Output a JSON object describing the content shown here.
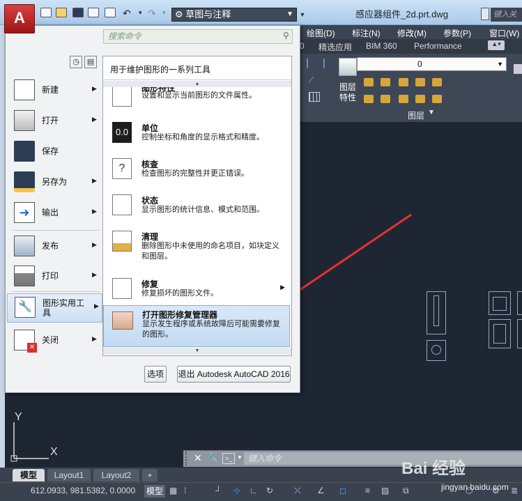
{
  "titlebar": {
    "logo": "A",
    "workspace": "草图与注释",
    "window_title": "感应器组件_2d.prt.dwg",
    "search_placeholder": "键入关键字"
  },
  "menubar": {
    "items": [
      "绘图(D)",
      "标注(N)",
      "修改(M)",
      "参数(P)",
      "窗口(W)"
    ]
  },
  "ribbon_tabs": {
    "items": [
      "0",
      "精选应用",
      "BIM 360",
      "Performance"
    ]
  },
  "ribbon_panel": {
    "layer_value": "0",
    "layer_button_label": "图层\n特性",
    "panel_title": "图层"
  },
  "app_menu": {
    "search_placeholder": "搜索命令",
    "items": [
      {
        "label": "新建",
        "icon": "new-file-icon"
      },
      {
        "label": "打开",
        "icon": "open-folder-icon"
      },
      {
        "label": "保存",
        "icon": "save-disk-icon"
      },
      {
        "label": "另存为",
        "icon": "save-as-icon"
      },
      {
        "label": "输出",
        "icon": "export-icon"
      },
      {
        "label": "发布",
        "icon": "publish-icon"
      },
      {
        "label": "打印",
        "icon": "printer-icon"
      },
      {
        "label": "图形实用工具",
        "icon": "wrench-icon"
      },
      {
        "label": "关闭",
        "icon": "close-file-icon"
      }
    ],
    "options_button": "选项",
    "exit_button": "退出 Autodesk AutoCAD 2016"
  },
  "submenu": {
    "title": "用于维护图形的一系列工具",
    "items": [
      {
        "title": "图形特性",
        "desc": "设置和显示当前图形的文件属性。"
      },
      {
        "title": "单位",
        "desc": "控制坐标和角度的显示格式和精度。"
      },
      {
        "title": "核查",
        "desc": "检查图形的完整性并更正错误。"
      },
      {
        "title": "状态",
        "desc": "显示图形的统计信息、模式和范围。"
      },
      {
        "title": "清理",
        "desc": "删除图形中未使用的命名项目，如块定义和图层。"
      },
      {
        "title": "修复",
        "desc": "修复损坏的图形文件。"
      },
      {
        "title": "打开图形修复管理器",
        "desc": "显示发生程序或系统故障后可能需要修复的图形。"
      }
    ]
  },
  "drawing": {
    "ucs_x": "X",
    "ucs_y": "Y"
  },
  "command_line": {
    "placeholder": "键入命令"
  },
  "layout_tabs": {
    "items": [
      "模型",
      "Layout1",
      "Layout2"
    ],
    "add": "+"
  },
  "status_bar": {
    "coords": "612.0933, 981.5382, 0.0000",
    "model": "模型"
  },
  "watermark": {
    "text": "Bai 经验",
    "sub": "jingyan.baidu.com"
  },
  "colors": {
    "annotation_arrow": "#e8312f",
    "canvas": "#1f2633",
    "highlight": "#cfe0f1"
  }
}
